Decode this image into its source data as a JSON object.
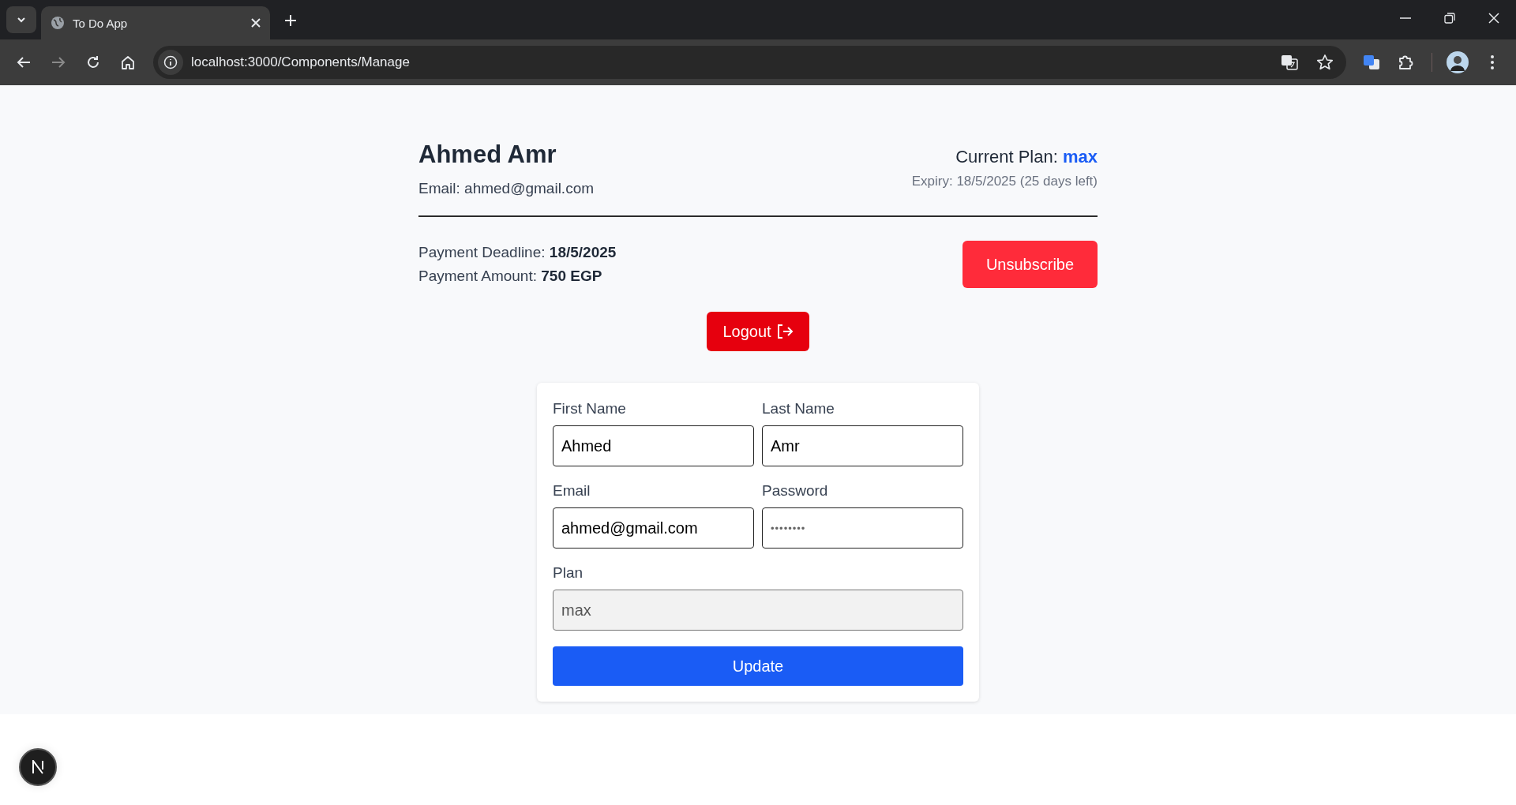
{
  "browser": {
    "tab_title": "To Do App",
    "url": "localhost:3000/Components/Manage"
  },
  "profile": {
    "name": "Ahmed Amr",
    "email": "Email: ahmed@gmail.com",
    "plan_label": "Current Plan:",
    "plan": "max",
    "expiry": "Expiry: 18/5/2025 (25 days left)"
  },
  "payment": {
    "deadline_label": "Payment Deadline:",
    "deadline": "18/5/2025",
    "amount_label": "Payment Amount:",
    "amount": "750 EGP"
  },
  "unsubscribe_button": "Unsubscribe",
  "logout_button": "Logout",
  "form": {
    "fields": [
      {
        "label": "First Name",
        "value": "Ahmed",
        "kind": "text",
        "disabled": false
      },
      {
        "label": "Last Name",
        "value": "Amr",
        "kind": "text",
        "disabled": false
      },
      {
        "label": "Email",
        "value": "ahmed@gmail.com",
        "kind": "text",
        "disabled": false
      },
      {
        "label": "Password",
        "value": "••••••••",
        "kind": "password",
        "disabled": false
      },
      {
        "label": "Plan",
        "value": "max",
        "kind": "text",
        "disabled": true
      }
    ],
    "submit": "Update"
  }
}
